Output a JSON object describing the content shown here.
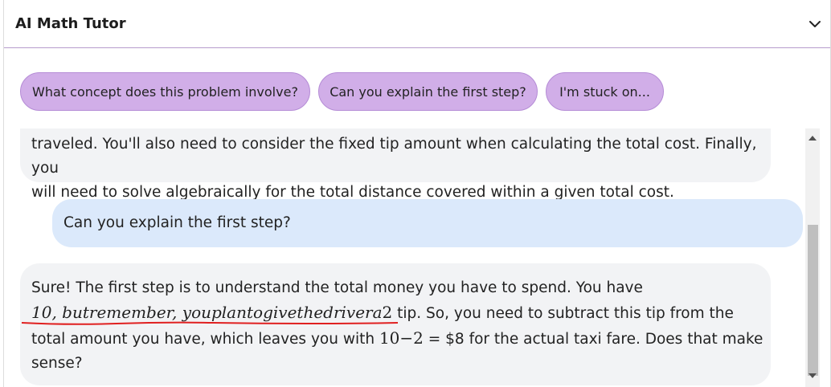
{
  "header": {
    "title": "AI Math Tutor"
  },
  "chips": [
    "What concept does this problem involve?",
    "Can you explain the first step?",
    "I'm stuck on..."
  ],
  "messages": {
    "ai1": {
      "line1": "traveled. You'll also need to consider the fixed tip amount when calculating the total cost. Finally, you",
      "line2": "will need to solve algebraically for the total distance covered within a given total cost."
    },
    "user1": {
      "text": "Can you explain the first step?"
    },
    "ai2": {
      "line1": "Sure! The first step is to understand the total money you have to spend. You have",
      "math1": "10, butremember, youplantogivethedrivera",
      "math1_tail_num": "2",
      "line2_rest": " tip. So, you need to subtract this tip from the",
      "line3_a": "total amount you have, which leaves you with ",
      "line3_math": "10−2",
      "line3_b": " = $8 for the actual taxi fare. Does that make",
      "line4": "sense?"
    }
  },
  "colors": {
    "chip_bg": "#d1aee8",
    "ai_bubble": "#f2f3f5",
    "user_bubble": "#dbe9fb",
    "squiggle": "#e02020"
  }
}
